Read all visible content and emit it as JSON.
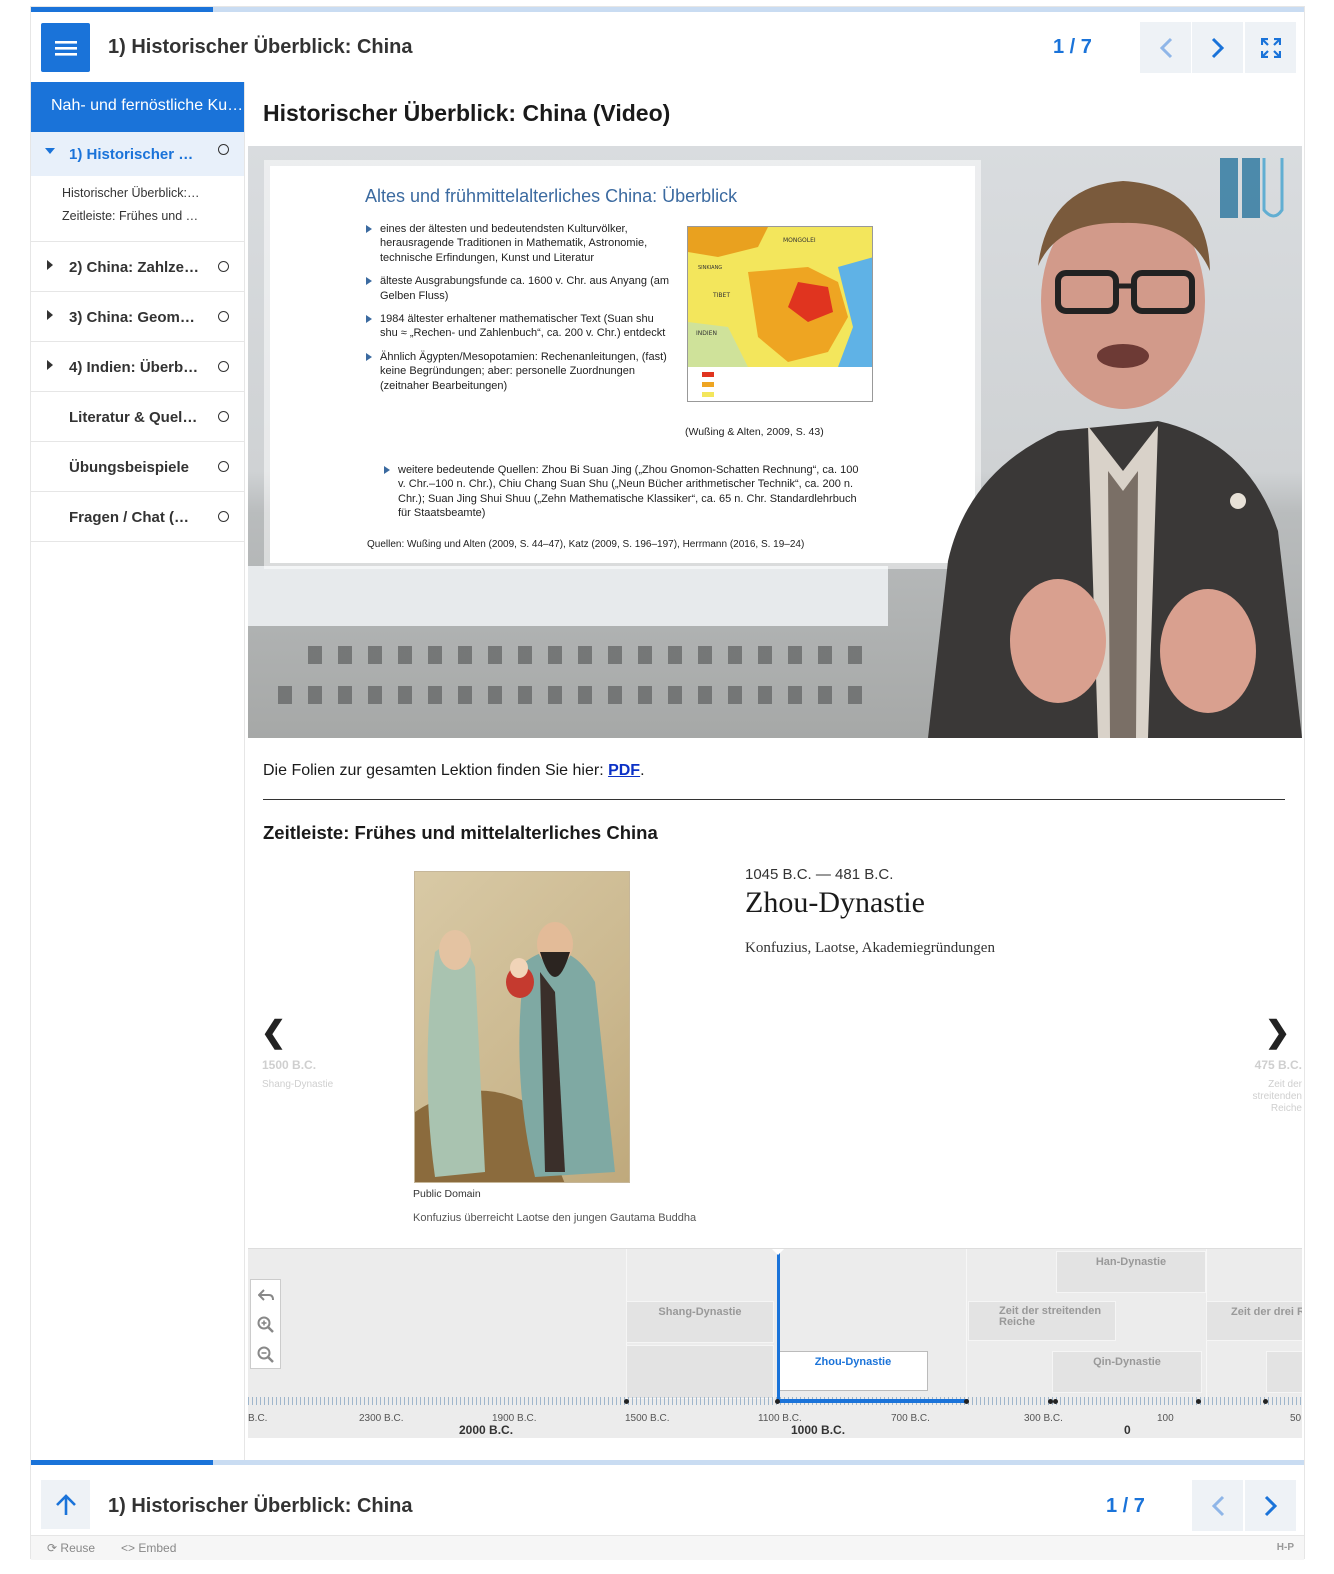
{
  "header": {
    "title": "1) Historischer Überblick: China",
    "counter": "1 / 7",
    "progress_fraction": 0.143
  },
  "sidebar": {
    "course_title": "Nah- und fernöstliche Ku…",
    "chapters": [
      {
        "label": "1) Historischer …",
        "expanded": true,
        "active": true
      },
      {
        "label": "2) China: Zahlze…"
      },
      {
        "label": "3) China: Geom…"
      },
      {
        "label": "4) Indien: Überb…"
      },
      {
        "label": "Literatur & Quel…"
      },
      {
        "label": "Übungsbeispiele"
      },
      {
        "label": "Fragen / Chat (…"
      }
    ],
    "sub_items": [
      "Historischer Überblick:…",
      "Zeitleiste: Frühes und …"
    ]
  },
  "main": {
    "title": "Historischer Überblick: China (Video)",
    "video": {
      "slide_title": "Altes und frühmittelalterliches China: Überblick",
      "bullets": [
        "eines der ältesten und bedeutendsten Kulturvölker, herausragende Traditionen in Mathematik, Astronomie, technische Erfindungen, Kunst und Literatur",
        "älteste Ausgrabungsfunde ca. 1600 v. Chr. aus Anyang (am Gelben Fluss)",
        "1984 ältester erhaltener mathematischer Text (Suan shu shu ≈ „Rechen- und Zahlenbuch“, ca. 200 v. Chr.) entdeckt",
        "Ähnlich Ägypten/Mesopotamien: Rechenanleitungen, (fast) keine Begründungen; aber: personelle Zuordnungen (zeitnaher Bearbeitungen)"
      ],
      "wide_bullet": "weitere bedeutende Quellen: Zhou Bi Suan Jing („Zhou Gnomon-Schatten Rechnung“, ca. 100 v. Chr.–100 n. Chr.), Chiu Chang Suan Shu („Neun Bücher arithmetischer Technik“, ca. 200 n. Chr.); Suan Jing Shui Shuu („Zehn Mathematische Klassiker“, ca. 65 n. Chr. Standardlehrbuch für Staatsbeamte)",
      "map_citation": "(Wußing & Alten, 2009, S. 43)",
      "sources": "Quellen: Wußing und Alten (2009, S. 44–47), Katz (2009, S. 196–197), Herrmann (2016, S. 19–24)",
      "map_labels": {
        "mongolei": "MONGOLEI",
        "tibet": "TIBET",
        "indien": "INDIEN",
        "sinkiang": "SINKIANG"
      }
    },
    "pdf_text": "Die Folien zur gesamten Lektion finden Sie hier: ",
    "pdf_link": "PDF",
    "pdf_suffix": ".",
    "timeline_heading": "Zeitleiste: Frühes und mittelalterliches China",
    "timeline": {
      "dates": "1045 B.C. — 481 B.C.",
      "headline": "Zhou-Dynastie",
      "text": "Konfuzius, Laotse, Akademiegründungen",
      "image_credit": "Public Domain",
      "image_caption": "Konfuzius überreicht Laotse den jungen Gautama Buddha",
      "prev": {
        "year": "1500 B.C.",
        "name": "Shang-Dynastie"
      },
      "next": {
        "year": "475 B.C.",
        "name": "Zeit der streitenden Reiche"
      },
      "eras": {
        "shang": "Shang-Dynastie",
        "zhou": "Zhou-Dynastie",
        "streitende": "Zeit der streitenden Reiche",
        "han": "Han-Dynastie",
        "qin": "Qin-Dynastie",
        "drei": "Zeit der drei R"
      },
      "ticks": [
        "B.C.",
        "2300 B.C.",
        "1900 B.C.",
        "1500 B.C.",
        "1100 B.C.",
        "700 B.C.",
        "300 B.C.",
        "100",
        "50"
      ],
      "major_ticks": [
        "2000 B.C.",
        "1000 B.C.",
        "0"
      ]
    }
  },
  "footer": {
    "title": "1) Historischer Überblick: China",
    "counter": "1 / 7",
    "reuse": "Reuse",
    "embed": "Embed",
    "brand": "H-P"
  },
  "colors": {
    "accent": "#1a73d9",
    "link": "#0b31c6"
  }
}
